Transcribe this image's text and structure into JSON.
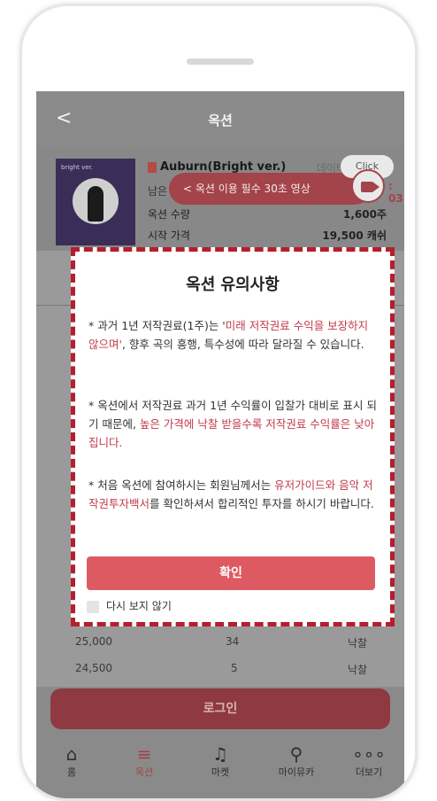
{
  "appbar": {
    "back": "<",
    "title": "옥션"
  },
  "info": {
    "album_text": "bright ver.",
    "song": "Auburn(Bright ver.)",
    "top_right": "데이터",
    "artist_line": "남은",
    "auction_qty_label": "옥션 수량",
    "auction_qty_value": "1,600주",
    "start_price_label": "시작 가격",
    "start_price_value": "19,500 캐쉬"
  },
  "tooltip": {
    "text": "< 옥션 이용 필수 30초 영상",
    "click": "Click",
    "time": ": 03"
  },
  "bids": [
    {
      "price": "25,000",
      "count": "34",
      "status": "낙찰"
    },
    {
      "price": "24,500",
      "count": "5",
      "status": "낙찰"
    }
  ],
  "login_button": "로그인",
  "nav": [
    {
      "icon": "⌂",
      "label": "홈"
    },
    {
      "icon": "≡",
      "label": "옥션"
    },
    {
      "icon": "♫",
      "label": "마켓"
    },
    {
      "icon": "⚲",
      "label": "마이뮤카"
    },
    {
      "icon": "∘∘∘",
      "label": "더보기"
    }
  ],
  "modal": {
    "title": "옥션 유의사항",
    "p1_pre": "* 과거 1년 저작권료(1주)는 '",
    "p1_red": "미래 저작권료 수익을 보장하지 않으며'",
    "p1_post": ", 향후 곡의 흥행, 특수성에 따라 달라질 수 있습니다.",
    "p2_pre": "* 옥션에서 저작권료 과거 1년 수익률이 입찰가 대비로 표시 되기 때문에, ",
    "p2_red": "높은 가격에 낙찰 받을수록 저작권료 수익률은 낮아집니다.",
    "p3_pre": "* 처음 옥션에 참여하시는 회원님께서는 ",
    "p3_red": "유저가이드와 음악 저작권투자백서",
    "p3_post": "를 확인하셔서 합리적인 투자를 하시기 바랍니다.",
    "confirm": "확인",
    "dont_show": "다시 보지 않기"
  }
}
